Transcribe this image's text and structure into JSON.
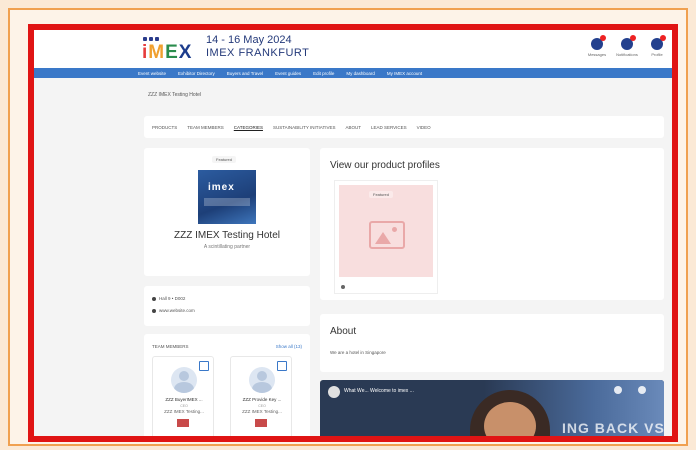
{
  "header": {
    "logo_text": "IMEX",
    "event_date": "14 - 16 May 2024",
    "event_name": "IMEX FRANKFURT",
    "icons": [
      {
        "name": "messages-icon",
        "label": "Messages"
      },
      {
        "name": "notifications-icon",
        "label": "Notifications"
      },
      {
        "name": "profile-icon",
        "label": "Profile"
      }
    ]
  },
  "nav": {
    "items": [
      "Event website",
      "Exhibitor Directory",
      "Buyers and Travel",
      "Event guides",
      "Edit profile",
      "My dashboard",
      "My IMEX account"
    ]
  },
  "breadcrumb": "ZZZ IMEX Testing Hotel",
  "tabs": [
    {
      "label": "PRODUCTS",
      "active": false
    },
    {
      "label": "TEAM MEMBERS",
      "active": false
    },
    {
      "label": "CATEGORIES",
      "active": true
    },
    {
      "label": "SUSTAINABILITY INITIATIVES",
      "active": false
    },
    {
      "label": "ABOUT",
      "active": false
    },
    {
      "label": "LEAD SERVICES",
      "active": false
    },
    {
      "label": "VIDEO",
      "active": false
    }
  ],
  "profile": {
    "featured_label": "Featured",
    "company_name": "ZZZ IMEX Testing Hotel",
    "tagline": "A scintillating partner",
    "image_text": "imex"
  },
  "contact": {
    "stand": "Hall 9 • D002",
    "website": "www.website.com"
  },
  "team": {
    "heading": "TEAM MEMBERS",
    "show_all": "Show all (13)",
    "members": [
      {
        "name": "ZZZ BuyerIMEX ...",
        "role": "CEO",
        "company": "ZZZ IMEX Testing..."
      },
      {
        "name": "ZZZ Provide Key ...",
        "role": "CEO",
        "company": "ZZZ IMEX Testing..."
      }
    ]
  },
  "products": {
    "title": "View our product profiles",
    "featured_label": "Featured"
  },
  "about": {
    "title": "About",
    "text": "We are a hotel in Singapore"
  },
  "video": {
    "title": "What We... Welcome to imex ...",
    "overlay_text": "ING BACK VS. G"
  }
}
